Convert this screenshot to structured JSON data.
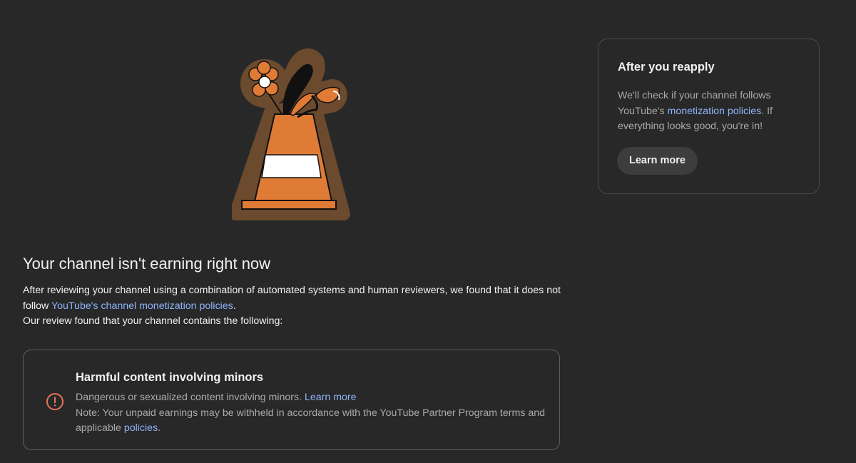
{
  "illustration": {
    "name": "traffic-cone-with-flower-illustration"
  },
  "status": {
    "title": "Your channel isn't earning right now",
    "review_text_1": "After reviewing your channel using a combination of automated systems and human reviewers, we found that it does not follow ",
    "policy_link": "YouTube's channel monetization policies",
    "review_text_2": ".",
    "review_found": "Our review found that your channel contains the following:"
  },
  "issue": {
    "icon": "error-circle-icon",
    "icon_color": "#e8735a",
    "title": "Harmful content involving minors",
    "description": "Dangerous or sexualized content involving minors. ",
    "learn_more": "Learn more",
    "note": "Note: Your unpaid earnings may be withheld in accordance with the YouTube Partner Program terms and applicable ",
    "policies_link": "policies",
    "note_end": "."
  },
  "reapply": {
    "title": "After you reapply",
    "text_1": "We'll check if your channel follows YouTube's ",
    "link": "monetization policies",
    "text_2": ". If everything looks good, you're in!",
    "button": "Learn more"
  },
  "colors": {
    "background": "#282828",
    "link": "#8fb4f9",
    "cone_orange": "#e07b35",
    "cone_outline": "#6b4a2e"
  }
}
